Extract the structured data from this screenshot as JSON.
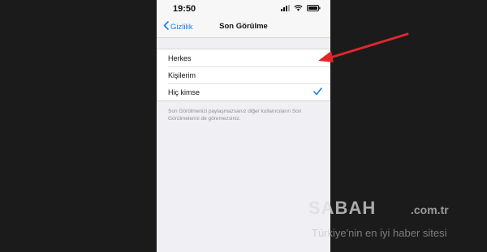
{
  "status_bar": {
    "time": "19:50"
  },
  "nav": {
    "back_label": "Gizlilik",
    "title": "Son Görülme"
  },
  "options": [
    {
      "label": "Herkes",
      "selected": false
    },
    {
      "label": "Kişilerim",
      "selected": false
    },
    {
      "label": "Hiç kimse",
      "selected": true
    }
  ],
  "footer_note": "Son Görülmenizi paylaşmazsanız diğer kullanıcıların Son Görülmelerini de göremezsiniz.",
  "watermark": {
    "logo": "SABAH",
    "domain": ".com.tr",
    "slogan": "Türkiye'nin en iyi haber sitesi"
  },
  "colors": {
    "accent": "#1a7cf0",
    "arrow": "#e3262b",
    "background": "#efeff4"
  }
}
